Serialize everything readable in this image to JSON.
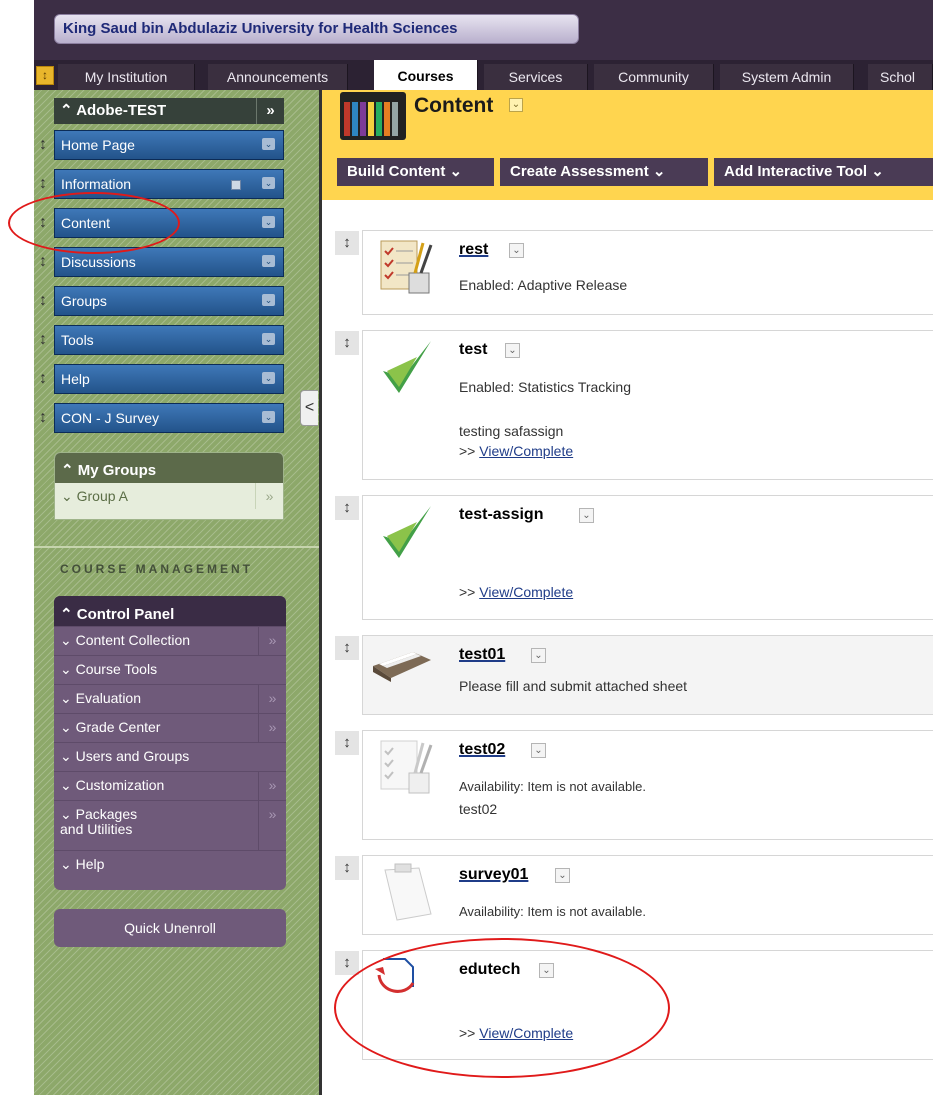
{
  "header": {
    "institution": "King Saud bin Abdulaziz University for Health Sciences"
  },
  "tabs": [
    {
      "label": "My Institution"
    },
    {
      "label": "Announcements"
    },
    {
      "label": "Courses"
    },
    {
      "label": "Services"
    },
    {
      "label": "Community"
    },
    {
      "label": "System Admin"
    },
    {
      "label": "Schol"
    }
  ],
  "active_tab": "Courses",
  "course_menu": {
    "course_name": "Adobe-TEST",
    "expand_glyph": "»",
    "collapse_glyph": "«",
    "items": [
      {
        "label": "Home Page"
      },
      {
        "label": "Information"
      },
      {
        "label": "Content"
      },
      {
        "label": "Discussions"
      },
      {
        "label": "Groups"
      },
      {
        "label": "Tools"
      },
      {
        "label": "Help"
      },
      {
        "label": "CON - J Survey"
      }
    ]
  },
  "my_groups": {
    "title": "My Groups",
    "groups": [
      {
        "label": "Group A"
      }
    ]
  },
  "course_management": {
    "label": "COURSE MANAGEMENT",
    "control_panel": {
      "title": "Control Panel",
      "items": [
        {
          "label": "Content Collection"
        },
        {
          "label": "Course Tools"
        },
        {
          "label": "Evaluation"
        },
        {
          "label": "Grade Center"
        },
        {
          "label": "Users and Groups"
        },
        {
          "label": "Customization"
        },
        {
          "label": "Packages and Utilities"
        },
        {
          "label": "Help"
        }
      ]
    },
    "quick_unenroll": "Quick Unenroll"
  },
  "content": {
    "title": "Content",
    "actions": [
      {
        "label": "Build Content"
      },
      {
        "label": "Create Assessment"
      },
      {
        "label": "Add Interactive Tool"
      }
    ],
    "items": [
      {
        "title": "rest",
        "meta_label": "Enabled:",
        "meta_value": "Adaptive Release",
        "icon": "assignment-icon"
      },
      {
        "title": "test",
        "meta_label": "Enabled:",
        "meta_value": "Statistics Tracking",
        "description": "testing safassign",
        "view_prefix": ">>",
        "view_link": "View/Complete",
        "icon": "safeassign-check-icon"
      },
      {
        "title": "test-assign",
        "view_prefix": ">>",
        "view_link": "View/Complete",
        "icon": "safeassign-check-icon"
      },
      {
        "title": "test01",
        "description": "Please fill and submit attached sheet",
        "icon": "file-box-icon"
      },
      {
        "title": "test02",
        "meta_label": "Availability:",
        "meta_value": "Item is not available.",
        "description": "test02",
        "icon": "assignment-icon"
      },
      {
        "title": "survey01",
        "meta_label": "Availability:",
        "meta_value": "Item is not available.",
        "icon": "survey-clipboard-icon"
      },
      {
        "title": "edutech",
        "view_prefix": ">>",
        "view_link": "View/Complete",
        "icon": "scorm-document-icon"
      }
    ]
  },
  "colors": {
    "top_bar": "#3c2e45",
    "course_menu_blue": "#23538a",
    "content_header_yellow": "#ffd54f",
    "control_panel_purple": "#6f5a7a",
    "annotation_red": "#e01a1a"
  }
}
